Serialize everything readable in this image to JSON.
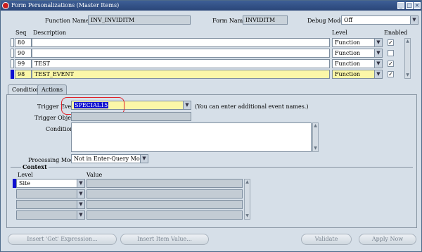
{
  "window": {
    "title": "Form Personalizations (Master Items)"
  },
  "header": {
    "function_name_label": "Function Name",
    "function_name_value": "INV_INVIDITM",
    "form_name_label": "Form Name",
    "form_name_value": "INVIDITM",
    "debug_mode_label": "Debug Mode",
    "debug_mode_value": "Off"
  },
  "grid": {
    "col_seq": "Seq",
    "col_description": "Description",
    "col_level": "Level",
    "col_enabled": "Enabled",
    "rows": [
      {
        "seq": "80",
        "description": "",
        "level": "Function",
        "enabled": true
      },
      {
        "seq": "90",
        "description": "",
        "level": "Function",
        "enabled": false
      },
      {
        "seq": "99",
        "description": "TEST",
        "level": "Function",
        "enabled": true
      },
      {
        "seq": "98",
        "description": "TEST_EVENT",
        "level": "Function",
        "enabled": true
      }
    ]
  },
  "tabs": {
    "condition": "Condition",
    "actions": "Actions"
  },
  "condition": {
    "trigger_event_label": "Trigger Event",
    "trigger_event_value": "SPECIAL15",
    "trigger_event_hint": "(You can enter additional event names.)",
    "trigger_object_label": "Trigger Object",
    "trigger_object_value": "",
    "condition_label": "Condition",
    "condition_value": "",
    "processing_mode_label": "Processing Mode",
    "processing_mode_value": "Not in Enter-Query Mode"
  },
  "context": {
    "title": "Context",
    "col_level": "Level",
    "col_value": "Value",
    "rows": [
      {
        "level": "Site",
        "value": ""
      },
      {
        "level": "",
        "value": ""
      },
      {
        "level": "",
        "value": ""
      },
      {
        "level": "",
        "value": ""
      }
    ]
  },
  "buttons": {
    "insert_expression": "Insert 'Get' Expression...",
    "insert_item_value": "Insert Item Value...",
    "validate": "Validate",
    "apply_now": "Apply Now"
  },
  "colors": {
    "title_bar": "#2a4578",
    "highlight": "#e0232a",
    "current_record": "#fbf7a8",
    "selection": "#1010d0"
  }
}
